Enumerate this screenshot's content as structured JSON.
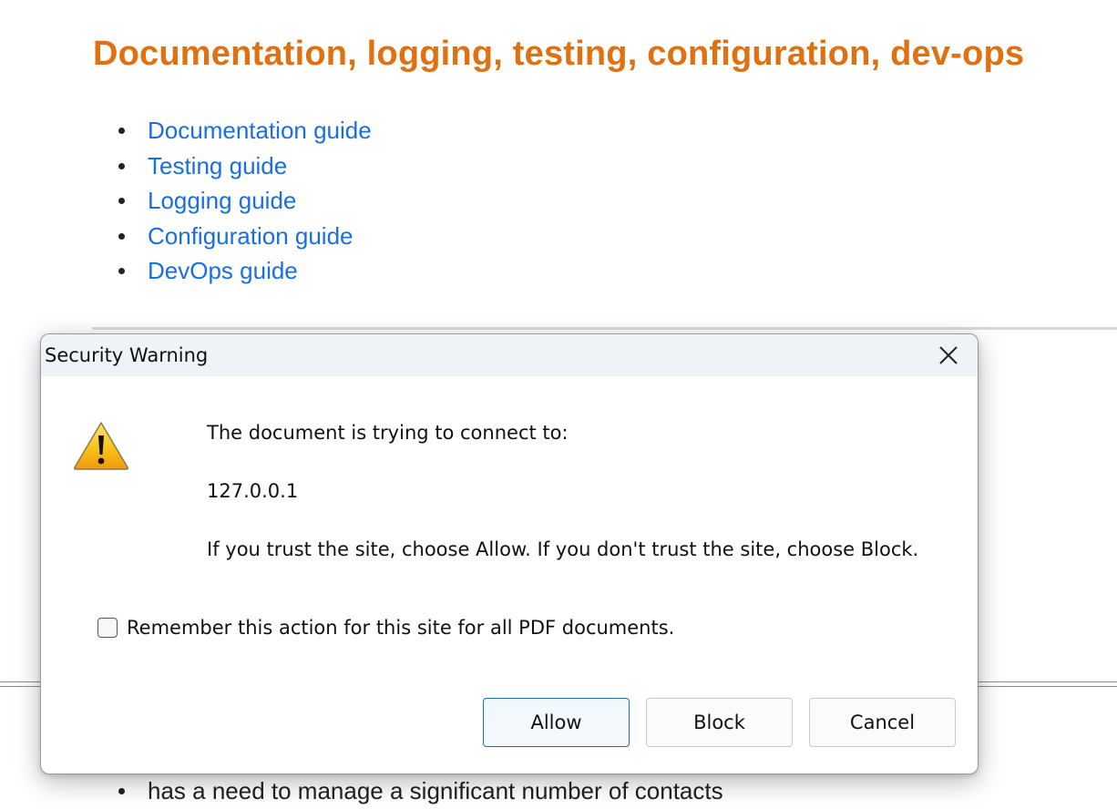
{
  "page": {
    "heading": "Documentation, logging, testing, configuration, dev-ops",
    "guides": [
      "Documentation guide",
      "Testing guide",
      "Logging guide",
      "Configuration guide",
      "DevOps guide"
    ],
    "bottom_bullet": "has a need to manage a significant number of contacts",
    "colors": {
      "heading": "#e07010",
      "link": "#1a6fe0"
    }
  },
  "dialog": {
    "title": "Security Warning",
    "icon": "warning-triangle-icon",
    "message_line": "The document is trying to connect to:",
    "host": "127.0.0.1",
    "advice": "If you trust the site, choose Allow. If you don't trust the site, choose Block.",
    "remember_label": "Remember this action for this site for all PDF documents.",
    "remember_checked": false,
    "buttons": {
      "allow": "Allow",
      "block": "Block",
      "cancel": "Cancel"
    },
    "default_button": "Allow"
  }
}
